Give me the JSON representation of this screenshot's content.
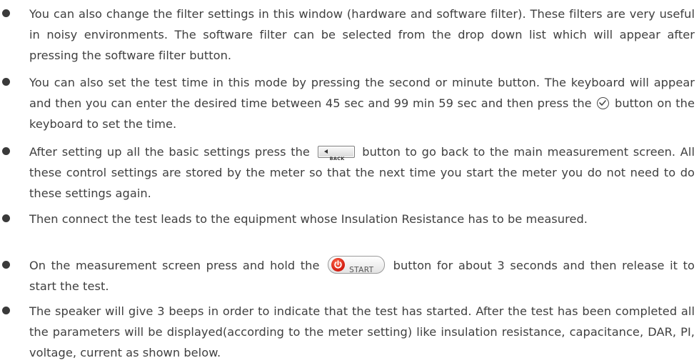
{
  "bullets": [
    {
      "text": "You can also change the filter settings in this window (hardware and software filter). These filters are very useful in noisy environments. The software filter can be selected from the drop down list which will appear after pressing the software filter button."
    },
    {
      "before": "You can also set the test time in this mode by pressing the second or minute button. The keyboard will appear and then you can enter the desired time between 45 sec and 99 min 59 sec and then press the",
      "after": "button on the keyboard to set the time.",
      "icon": "check-circle-icon"
    },
    {
      "before": "After setting up all the basic settings press the",
      "after": "button to go back to the main measurement screen. All these control settings are stored by the meter so that the next time you start the meter you do not need to do these settings again.",
      "button_label": "BACK"
    },
    {
      "text": "Then connect the test leads to the equipment whose Insulation Resistance has to be measured."
    },
    {
      "before": "On the measurement screen press and hold the",
      "after": "button for about 3 seconds and then release it to start the test.",
      "button_label": "START",
      "button_color": "#d11a10"
    },
    {
      "text": "The speaker will give 3 beeps in order to indicate that the test has started. After the test has been completed all the parameters will be displayed(according to the meter setting) like insulation resistance, capacitance, DAR, PI, voltage, current as shown below."
    }
  ]
}
